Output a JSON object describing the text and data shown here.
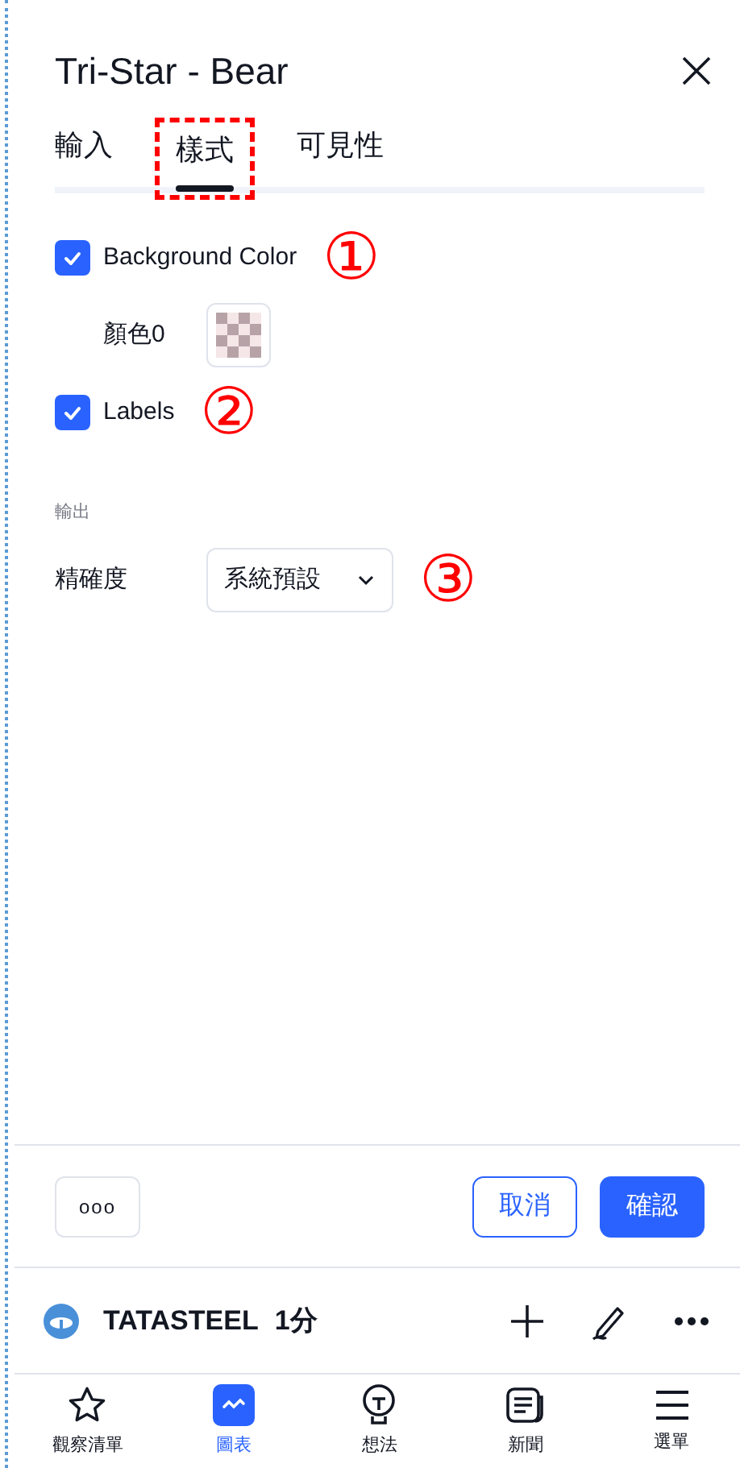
{
  "dialog": {
    "title": "Tri-Star - Bear",
    "tabs": [
      {
        "label": "輸入",
        "selected": false
      },
      {
        "label": "樣式",
        "selected": true
      },
      {
        "label": "可見性",
        "selected": false
      }
    ],
    "options": [
      {
        "kind": "checkbox",
        "label": "Background Color",
        "checked": true,
        "marker": "①"
      },
      {
        "kind": "color",
        "label": "顏色0"
      },
      {
        "kind": "checkbox",
        "label": "Labels",
        "checked": true,
        "marker": "②"
      },
      {
        "kind": "section",
        "label": "輸出"
      },
      {
        "kind": "select",
        "label": "精確度",
        "value": "系統預設",
        "marker": "③"
      }
    ],
    "more_button": "ooo",
    "cancel_button": "取消",
    "ok_button": "確認"
  },
  "symbol_bar": {
    "symbol": "TATASTEEL",
    "interval": "1分"
  },
  "bottom_nav": [
    {
      "kind": "star",
      "label": "觀察清單",
      "selected": false
    },
    {
      "kind": "chart",
      "label": "圖表",
      "selected": true
    },
    {
      "kind": "bulb",
      "label": "想法",
      "selected": false
    },
    {
      "kind": "news",
      "label": "新聞",
      "selected": false
    },
    {
      "kind": "menu",
      "label": "選單",
      "selected": false
    }
  ]
}
